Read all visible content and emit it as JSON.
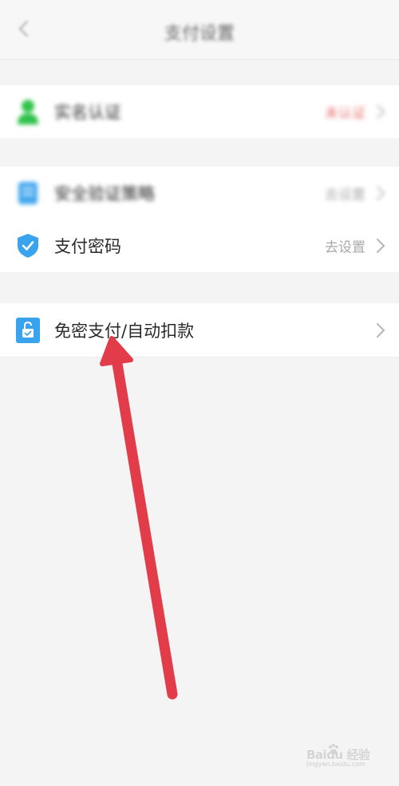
{
  "header": {
    "title": "支付设置"
  },
  "sections": [
    {
      "items": [
        {
          "label": "实名认证",
          "value": "未认证",
          "value_color": "#e66a6a"
        }
      ]
    },
    {
      "items": [
        {
          "label": "安全验证策略",
          "value": "去设置"
        },
        {
          "label": "支付密码",
          "value": "去设置"
        }
      ]
    },
    {
      "items": [
        {
          "label": "免密支付/自动扣款",
          "value": ""
        }
      ]
    }
  ],
  "watermark": {
    "text": "Baidu 经验",
    "sub": "jingyan.baidu.com"
  },
  "colors": {
    "page_background": "#f4f4f4",
    "annotation_arrow": "#e23b4a",
    "shield_icon": "#3aa3ee",
    "lock_icon": "#3aa3ee",
    "verify_icon": "#2fc24a"
  }
}
